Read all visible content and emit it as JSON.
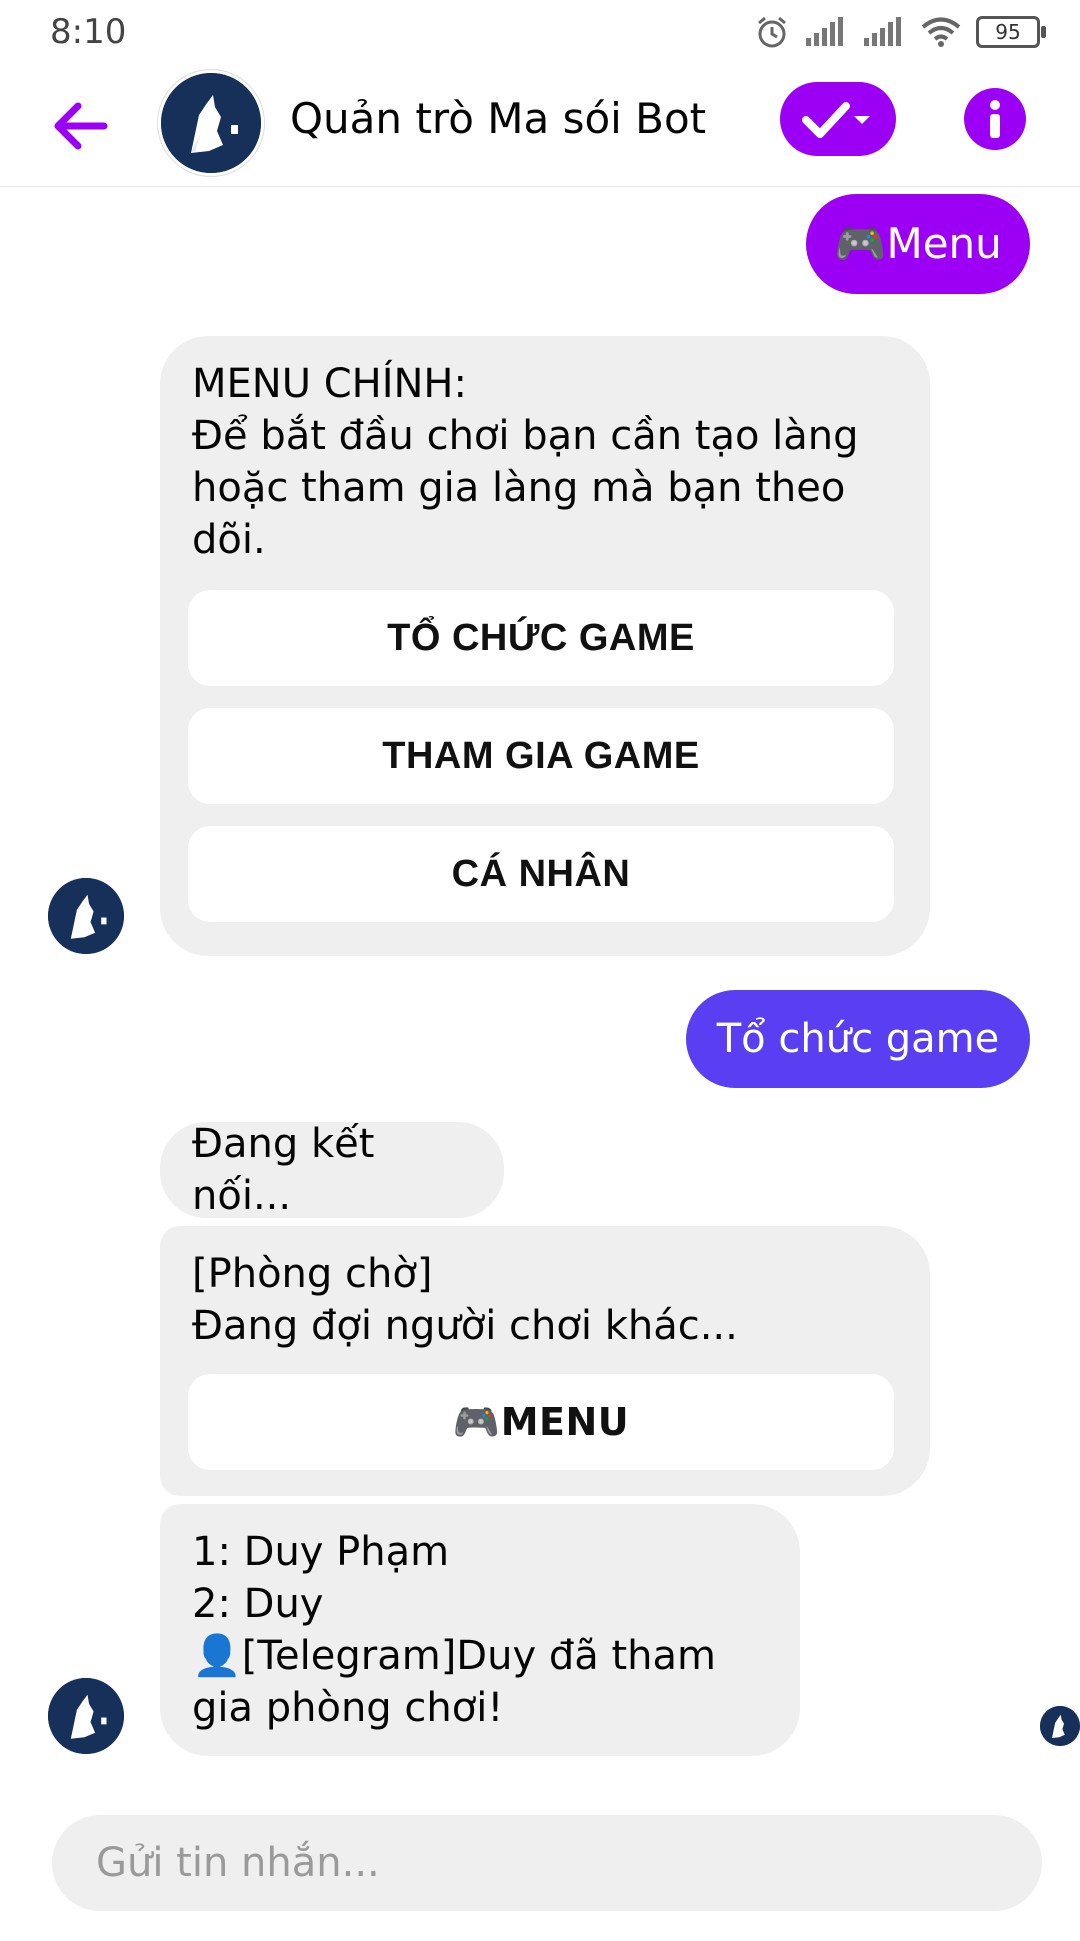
{
  "status": {
    "time": "8:10",
    "battery": "95"
  },
  "header": {
    "title": "Quản trò Ma sói Bot"
  },
  "colors": {
    "accent": "#9b00f5",
    "user_bubble_1": "#9b00f5",
    "user_bubble_2": "#5a3ff2",
    "bot_bubble": "#efefef"
  },
  "messages": {
    "m1": {
      "text": "🎮Menu"
    },
    "m2": {
      "text": "MENU CHÍNH:\nĐể bắt đầu chơi bạn cần tạo làng hoặc tham gia làng mà bạn theo dõi.",
      "buttons": [
        "TỔ CHỨC GAME",
        "THAM GIA GAME",
        "CÁ NHÂN"
      ]
    },
    "m3": {
      "text": "Tổ chức game"
    },
    "m4": {
      "text": "Đang kết nối..."
    },
    "m5": {
      "text": "[Phòng chờ]\nĐang đợi người chơi khác...",
      "button": "🎮MENU"
    },
    "m6": {
      "text": "1: Duy Phạm\n2: Duy\n👤[Telegram]Duy đã tham gia phòng chơi!"
    }
  },
  "composer": {
    "placeholder": "Gửi tin nhắn..."
  }
}
